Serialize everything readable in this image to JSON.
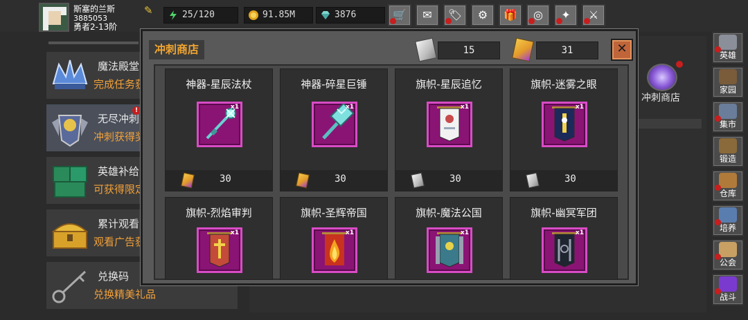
{
  "player": {
    "name": "斯塞的兰斯",
    "id": "3885053",
    "rank": "勇者2-13阶"
  },
  "resources": [
    {
      "icon": "energy-icon",
      "value": "25/120"
    },
    {
      "icon": "gold-coin-icon",
      "value": "91.85M"
    },
    {
      "icon": "diamond-icon",
      "value": "3876"
    }
  ],
  "toolbar": [
    {
      "icon": "shop-cart-icon",
      "glyph": "🛒",
      "badge": true
    },
    {
      "icon": "mail-icon",
      "glyph": "✉",
      "badge": false
    },
    {
      "icon": "gift-box-icon",
      "glyph": "🏷",
      "badge": true
    },
    {
      "icon": "settings-icon",
      "glyph": "⚙",
      "badge": false
    },
    {
      "icon": "present-icon",
      "glyph": "🎁",
      "badge": false
    },
    {
      "icon": "wheel-icon",
      "glyph": "◎",
      "badge": true
    },
    {
      "icon": "magic-wand-icon",
      "glyph": "✦",
      "badge": true
    },
    {
      "icon": "crossed-swords-icon",
      "glyph": "⚔",
      "badge": true
    }
  ],
  "left_list": [
    {
      "title": "魔法殿堂",
      "subtitle": "完成任务获",
      "icon": "crystal-crown-icon",
      "badge": false,
      "selected": false
    },
    {
      "title": "无尽冲刺",
      "subtitle": "冲刺获得奖",
      "icon": "knight-emblem-icon",
      "badge": true,
      "selected": true
    },
    {
      "title": "英雄补给",
      "subtitle": "可获得限定",
      "icon": "supply-crates-icon",
      "badge": false,
      "selected": false
    },
    {
      "title": "累计观看",
      "subtitle": "观看广告获",
      "icon": "treasure-chest-icon",
      "badge": false,
      "selected": false
    },
    {
      "title": "兑换码",
      "subtitle": "兑换精美礼品",
      "icon": "key-icon",
      "badge": false,
      "selected": false
    }
  ],
  "background_shop": {
    "label": "冲刺商店",
    "icon": "portal-orb-icon"
  },
  "right_nav": [
    {
      "label": "英雄",
      "icon": "hero-helmet-icon",
      "color": "#8a8f9a",
      "badge": true
    },
    {
      "label": "家园",
      "icon": "house-icon",
      "color": "#7a5b3a",
      "badge": false
    },
    {
      "label": "集市",
      "icon": "market-stall-icon",
      "color": "#6a7d9a",
      "badge": true
    },
    {
      "label": "锻造",
      "icon": "anvil-hammer-icon",
      "color": "#8a6a3a",
      "badge": false
    },
    {
      "label": "仓库",
      "icon": "storage-icon",
      "color": "#b07a3a",
      "badge": true
    },
    {
      "label": "培养",
      "icon": "training-icon",
      "color": "#5a7db0",
      "badge": true
    },
    {
      "label": "公会",
      "icon": "guild-lion-icon",
      "color": "#c8a064",
      "badge": true
    },
    {
      "label": "战斗",
      "icon": "battle-portal-icon",
      "color": "#7a3ad0",
      "badge": true
    }
  ],
  "shop": {
    "title": "冲刺商店",
    "currency_scroll": "15",
    "currency_gem": "31",
    "items": [
      {
        "name": "神器-星辰法杖",
        "qty": "x1",
        "icon": "star-staff-icon",
        "price_icon": "gem-currency-icon",
        "price": "30"
      },
      {
        "name": "神器-碎星巨锤",
        "qty": "x1",
        "icon": "star-hammer-icon",
        "price_icon": "gem-currency-icon",
        "price": "30"
      },
      {
        "name": "旗帜-星辰追忆",
        "qty": "x1",
        "icon": "banner-white-icon",
        "price_icon": "scroll-currency-icon",
        "price": "30"
      },
      {
        "name": "旗帜-迷雾之眼",
        "qty": "x1",
        "icon": "banner-navy-icon",
        "price_icon": "scroll-currency-icon",
        "price": "30"
      },
      {
        "name": "旗帜-烈焰审判",
        "qty": "x1",
        "icon": "banner-red-cross-icon"
      },
      {
        "name": "旗帜-圣辉帝国",
        "qty": "x1",
        "icon": "banner-flame-icon"
      },
      {
        "name": "旗帜-魔法公国",
        "qty": "x1",
        "icon": "banner-teal-icon"
      },
      {
        "name": "旗帜-幽冥军团",
        "qty": "x1",
        "icon": "banner-chain-icon"
      }
    ]
  },
  "colors": {
    "accent": "#f0a531",
    "item_frame": "#d94cc6",
    "badge": "#c81e1e"
  }
}
